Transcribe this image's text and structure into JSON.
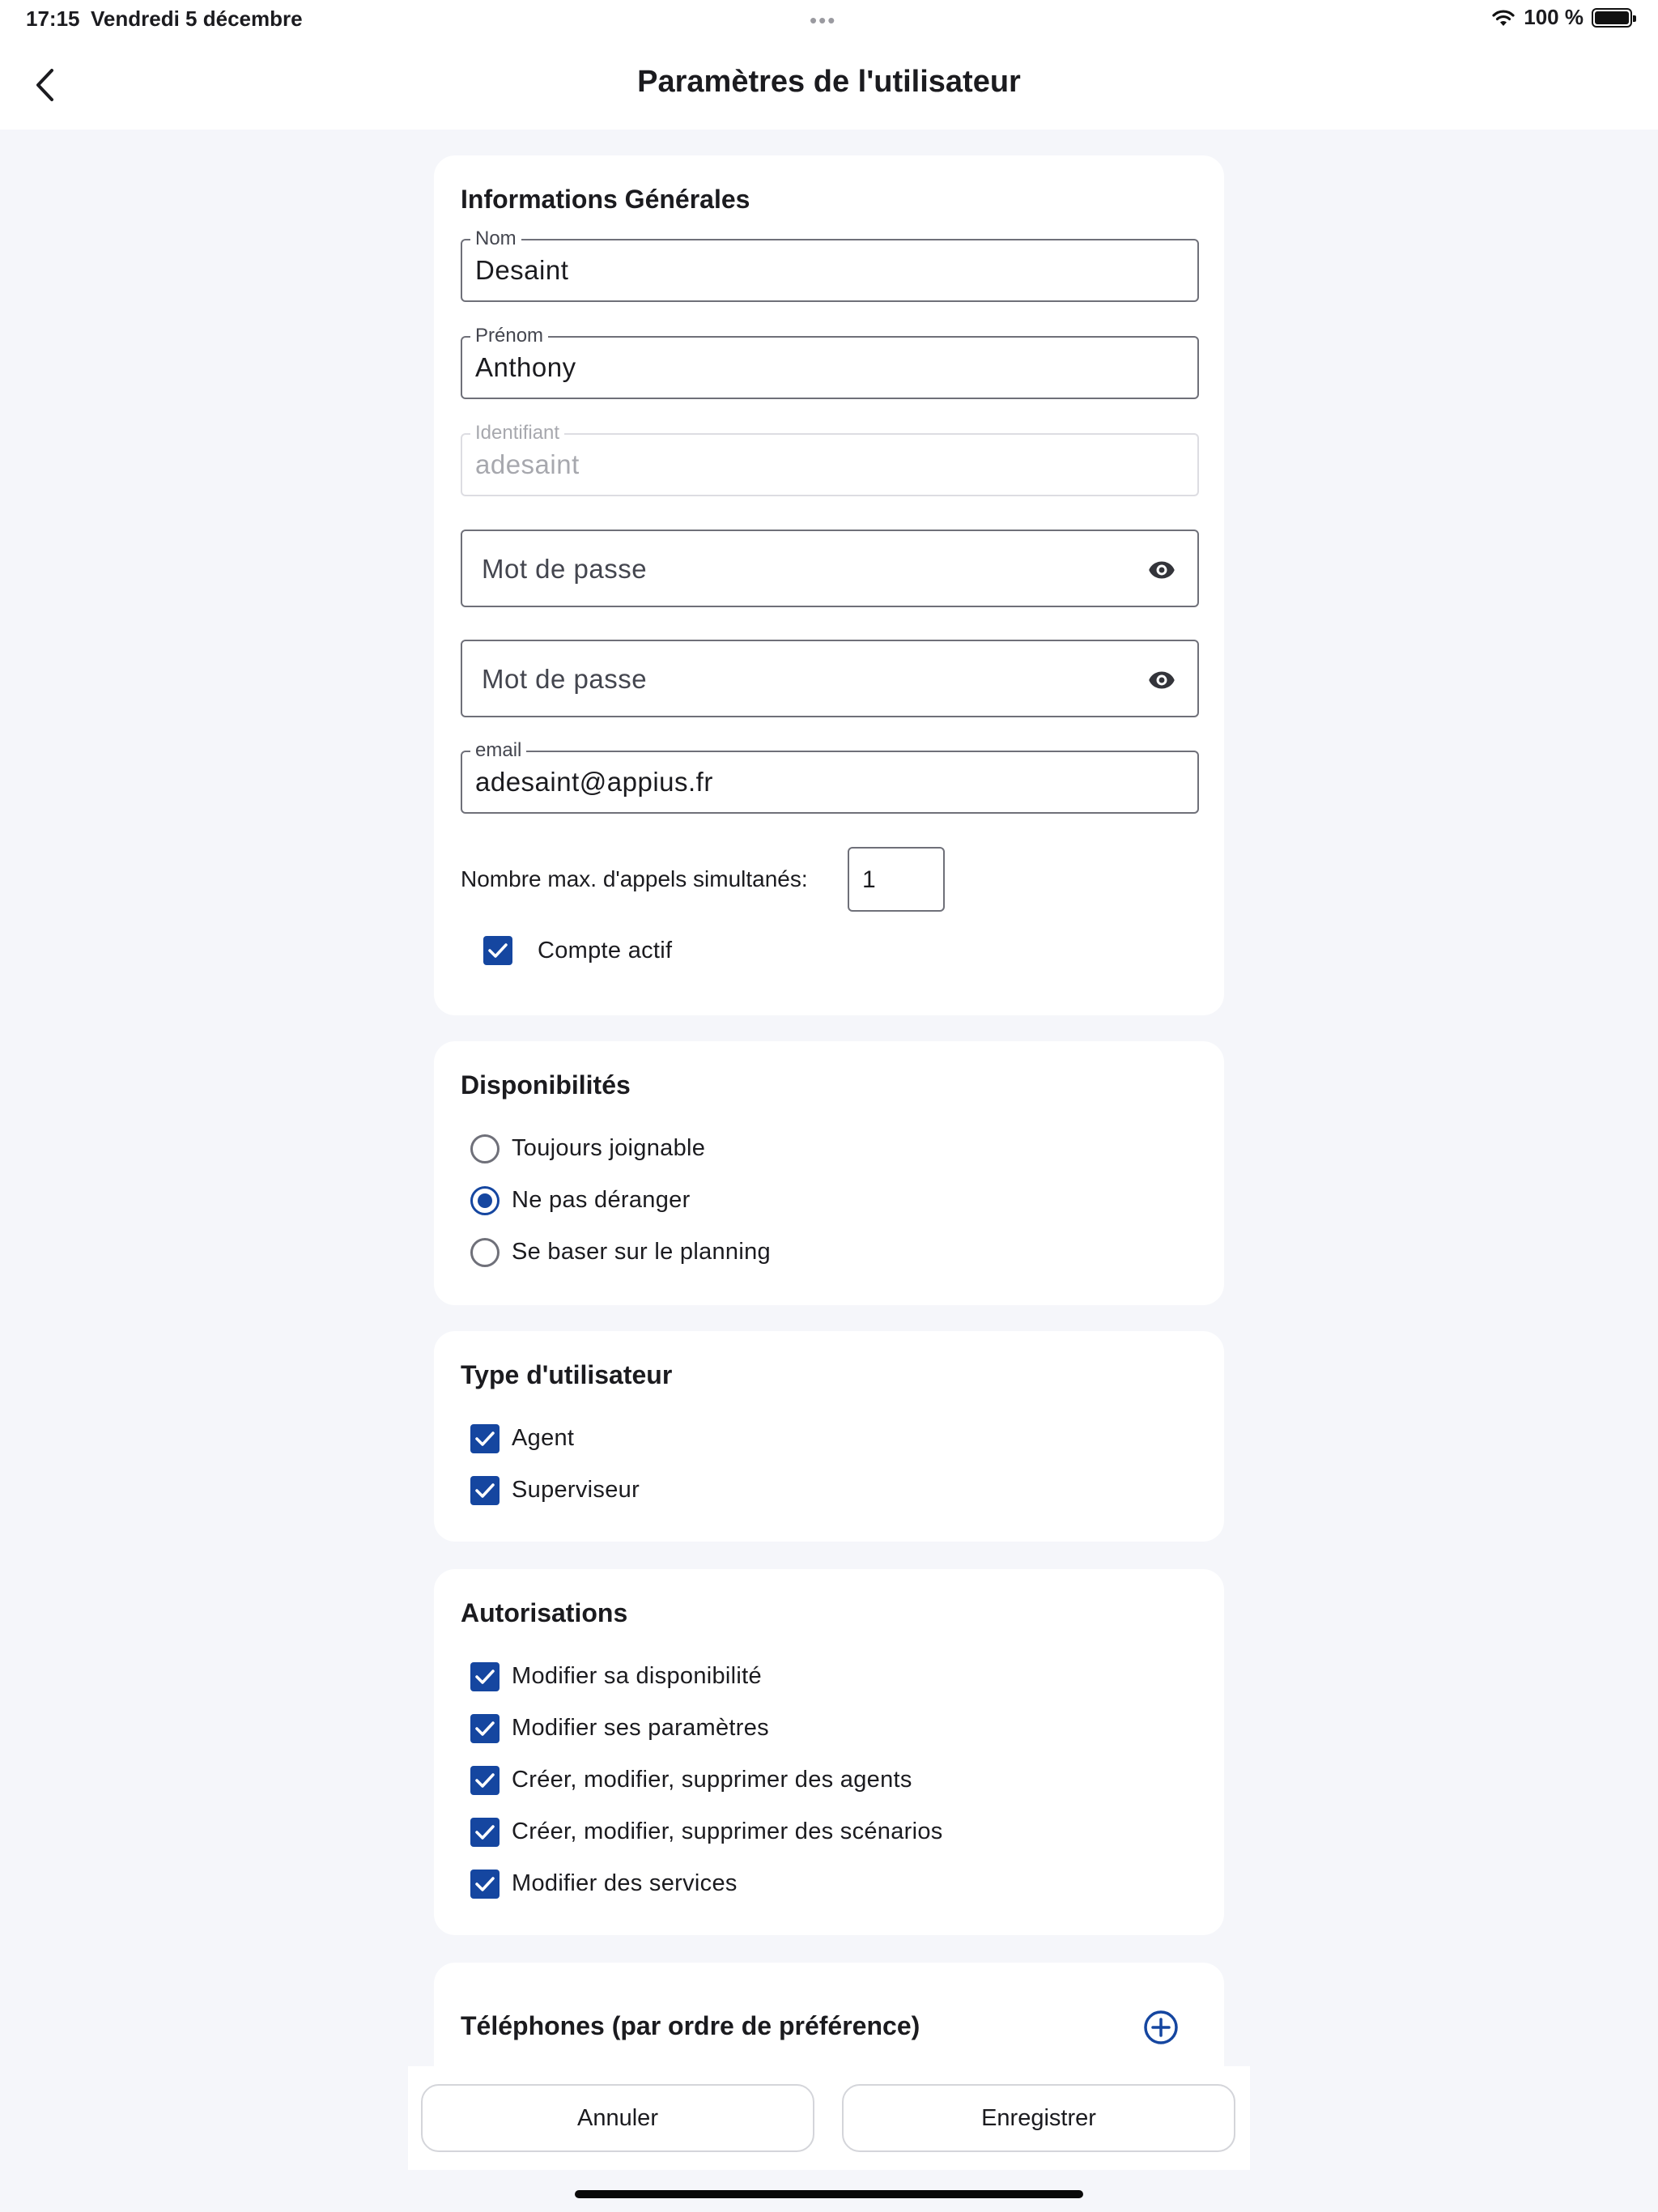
{
  "status_bar": {
    "time": "17:15",
    "date": "Vendredi 5 décembre",
    "battery": "100 %"
  },
  "header": {
    "title": "Paramètres de l'utilisateur"
  },
  "general": {
    "title": "Informations Générales",
    "nom_label": "Nom",
    "nom_value": "Desaint",
    "prenom_label": "Prénom",
    "prenom_value": "Anthony",
    "identifiant_label": "Identifiant",
    "identifiant_value": "adesaint",
    "password_placeholder": "Mot de passe",
    "password_confirm_placeholder": "Mot de passe",
    "email_label": "email",
    "email_value": "adesaint@appius.fr",
    "max_calls_label": "Nombre max. d'appels simultanés:",
    "max_calls_value": "1",
    "active_label": "Compte actif",
    "active_checked": true
  },
  "availability": {
    "title": "Disponibilités",
    "options": [
      {
        "label": "Toujours joignable",
        "selected": false
      },
      {
        "label": "Ne pas déranger",
        "selected": true
      },
      {
        "label": "Se baser sur le planning",
        "selected": false
      }
    ]
  },
  "user_type": {
    "title": "Type d'utilisateur",
    "options": [
      {
        "label": "Agent",
        "checked": true
      },
      {
        "label": "Superviseur",
        "checked": true
      }
    ]
  },
  "permissions": {
    "title": "Autorisations",
    "options": [
      {
        "label": "Modifier sa disponibilité",
        "checked": true
      },
      {
        "label": "Modifier ses paramètres",
        "checked": true
      },
      {
        "label": "Créer, modifier, supprimer des agents",
        "checked": true
      },
      {
        "label": "Créer, modifier, supprimer des scénarios",
        "checked": true
      },
      {
        "label": "Modifier des services",
        "checked": true
      }
    ]
  },
  "phones": {
    "title": "Téléphones (par ordre de préférence)"
  },
  "actions": {
    "cancel_label": "Annuler",
    "save_label": "Enregistrer"
  },
  "colors": {
    "accent": "#1546a0",
    "background": "#f5f6fa",
    "card": "#ffffff"
  }
}
